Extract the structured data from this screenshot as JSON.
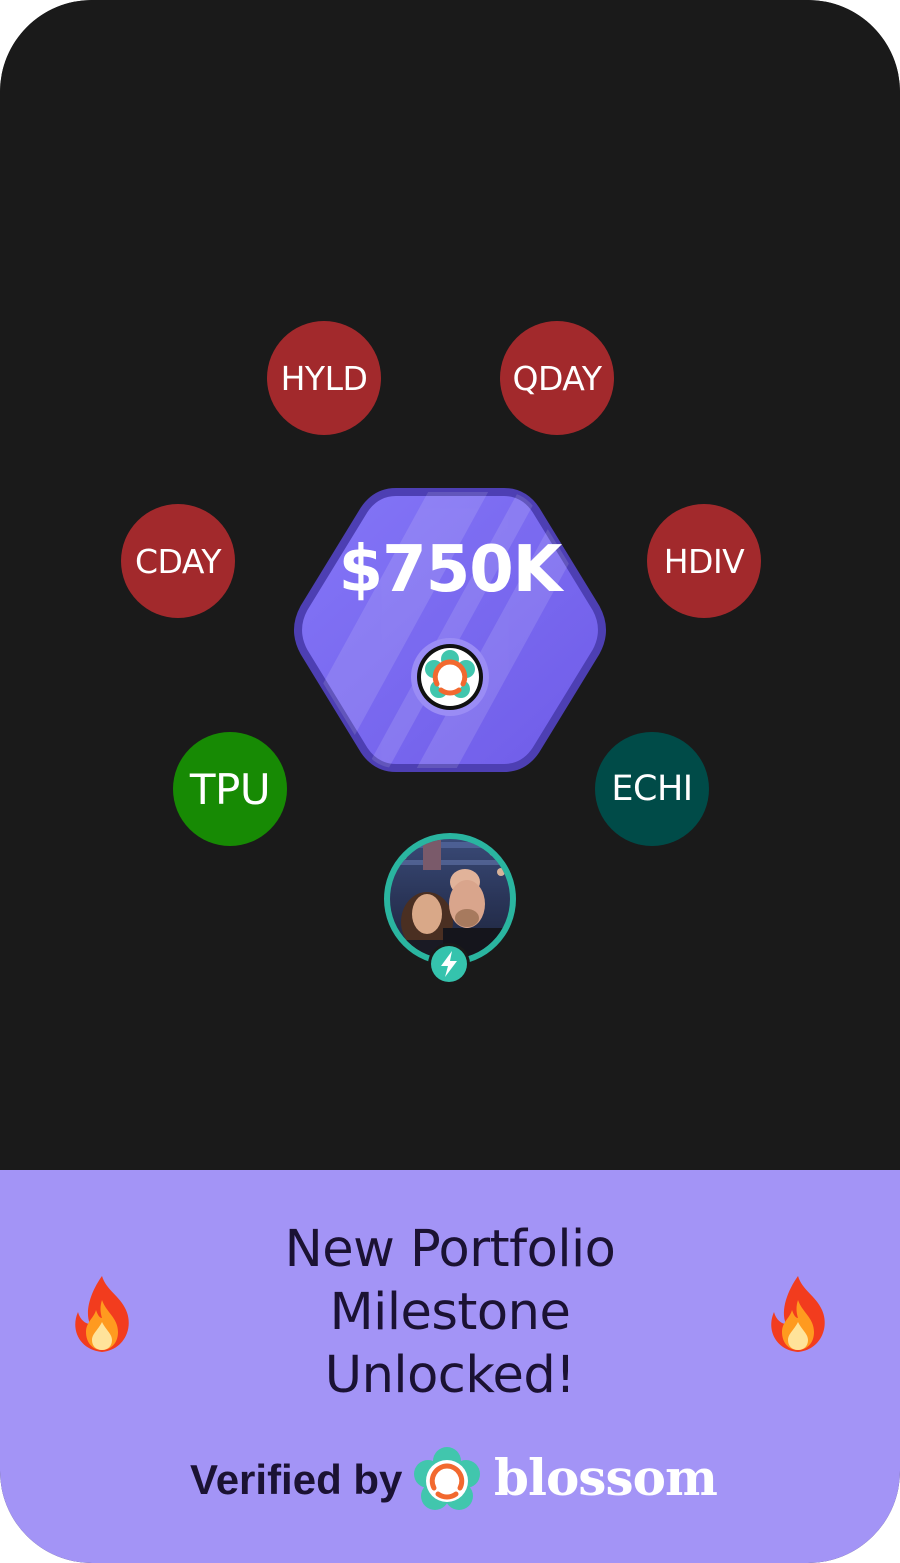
{
  "milestone": {
    "value": "$750K"
  },
  "holdings": [
    {
      "ticker": "HYLD",
      "color": "#a2292c"
    },
    {
      "ticker": "QDAY",
      "color": "#a2292c"
    },
    {
      "ticker": "CDAY",
      "color": "#a2292c"
    },
    {
      "ticker": "HDIV",
      "color": "#a2292c"
    },
    {
      "ticker": "TPU",
      "color": "#178a04"
    },
    {
      "ticker": "ECHI",
      "color": "#004b48"
    }
  ],
  "headline": {
    "line1": "New Portfolio",
    "line2": "Milestone",
    "line3": "Unlocked!"
  },
  "footer": {
    "verified_label": "Verified by",
    "brand_name": "blossom"
  },
  "colors": {
    "background": "#1a1a1a",
    "hexagon": "#7a69f2",
    "bottom_panel": "#a394f6",
    "avatar_ring": "#2ab5a0"
  },
  "icons": {
    "fire_left": "fire-icon",
    "fire_right": "fire-icon",
    "badge": "blossom-logo-icon",
    "avatar_badge": "lightning-bolt-icon"
  }
}
